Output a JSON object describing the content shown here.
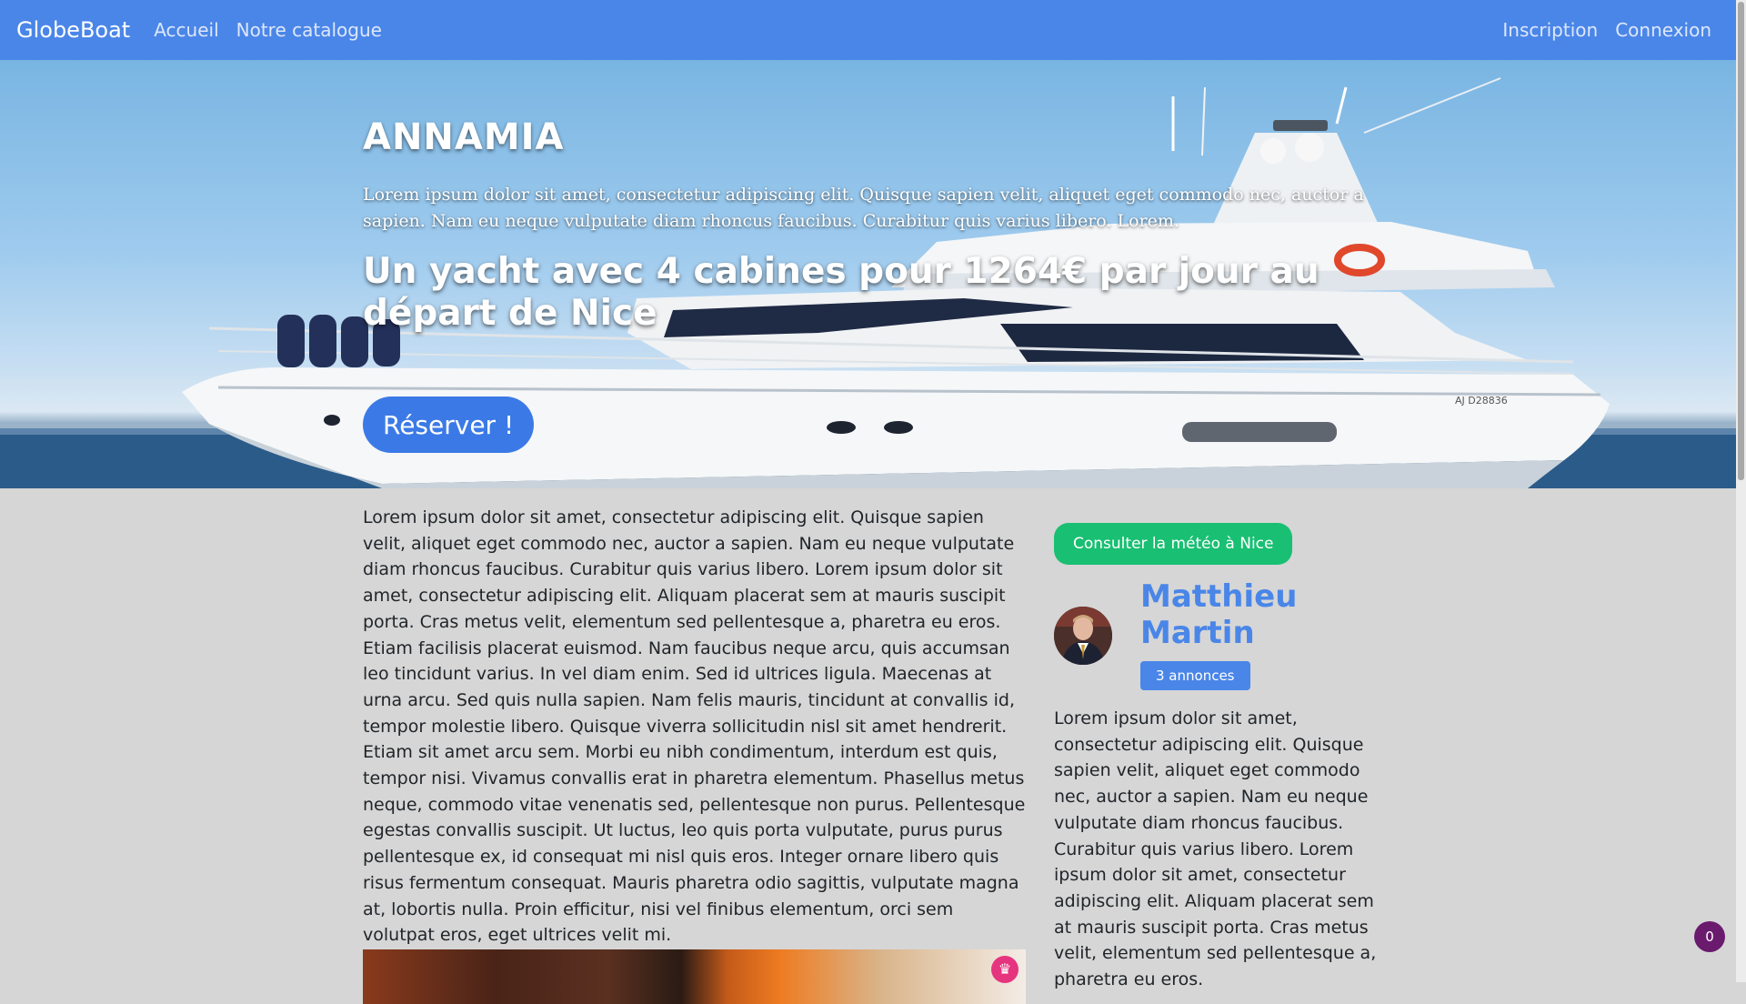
{
  "nav": {
    "brand": "GlobeBoat",
    "links": [
      "Accueil",
      "Notre catalogue"
    ],
    "right_links": [
      "Inscription",
      "Connexion"
    ]
  },
  "hero": {
    "title": "ANNAMIA",
    "description": "Lorem ipsum dolor sit amet, consectetur adipiscing elit. Quisque sapien velit, aliquet eget commodo nec, auctor a sapien. Nam eu neque vulputate diam rhoncus faucibus. Curabitur quis varius libero. Lorem.",
    "headline": "Un yacht avec 4 cabines pour 1264€ par jour au départ de Nice",
    "cta": "Réserver !",
    "hull_registration": "AJ D28836"
  },
  "main": {
    "text": "Lorem ipsum dolor sit amet, consectetur adipiscing elit. Quisque sapien velit, aliquet eget commodo nec, auctor a sapien. Nam eu neque vulputate diam rhoncus faucibus. Curabitur quis varius libero. Lorem ipsum dolor sit amet, consectetur adipiscing elit. Aliquam placerat sem at mauris suscipit porta. Cras metus velit, elementum sed pellentesque a, pharetra eu eros. Etiam facilisis placerat euismod. Nam faucibus neque arcu, quis accumsan leo tincidunt varius. In vel diam enim. Sed id ultrices ligula. Maecenas at urna arcu. Sed quis nulla sapien. Nam felis mauris, tincidunt at convallis id, tempor molestie libero. Quisque viverra sollicitudin nisl sit amet hendrerit. Etiam sit amet arcu sem. Morbi eu nibh condimentum, interdum est quis, tempor nisi. Vivamus convallis erat in pharetra elementum. Phasellus metus neque, commodo vitae venenatis sed, pellentesque non purus. Pellentesque egestas convallis suscipit. Ut luctus, leo quis porta vulputate, purus purus pellentesque ex, id consequat mi nisl quis eros. Integer ornare libero quis risus fermentum consequat. Mauris pharetra odio sagittis, vulputate magna at, lobortis nulla. Proin efficitur, nisi vel finibus elementum, orci sem volutpat eros, eget ultrices velit mi."
  },
  "sidebar": {
    "meteo_button": "Consulter la météo à Nice",
    "owner_name": "Matthieu Martin",
    "ads_badge": "3 annonces",
    "owner_text": "Lorem ipsum dolor sit amet, consectetur adipiscing elit. Quisque sapien velit, aliquet eget commodo nec, auctor a sapien. Nam eu neque vulputate diam rhoncus faucibus. Curabitur quis varius libero. Lorem ipsum dolor sit amet, consectetur adipiscing elit. Aliquam placerat sem at mauris suscipit porta. Cras metus velit, elementum sed pellentesque a, pharetra eu eros."
  },
  "counter": "0",
  "icons": {
    "crown": "crown-icon",
    "photo_badge": "premium-crown-badge"
  },
  "colors": {
    "primary": "#4a86e8",
    "success": "#19bf72",
    "counter": "#6a1b6e",
    "badge": "#e5357f"
  }
}
